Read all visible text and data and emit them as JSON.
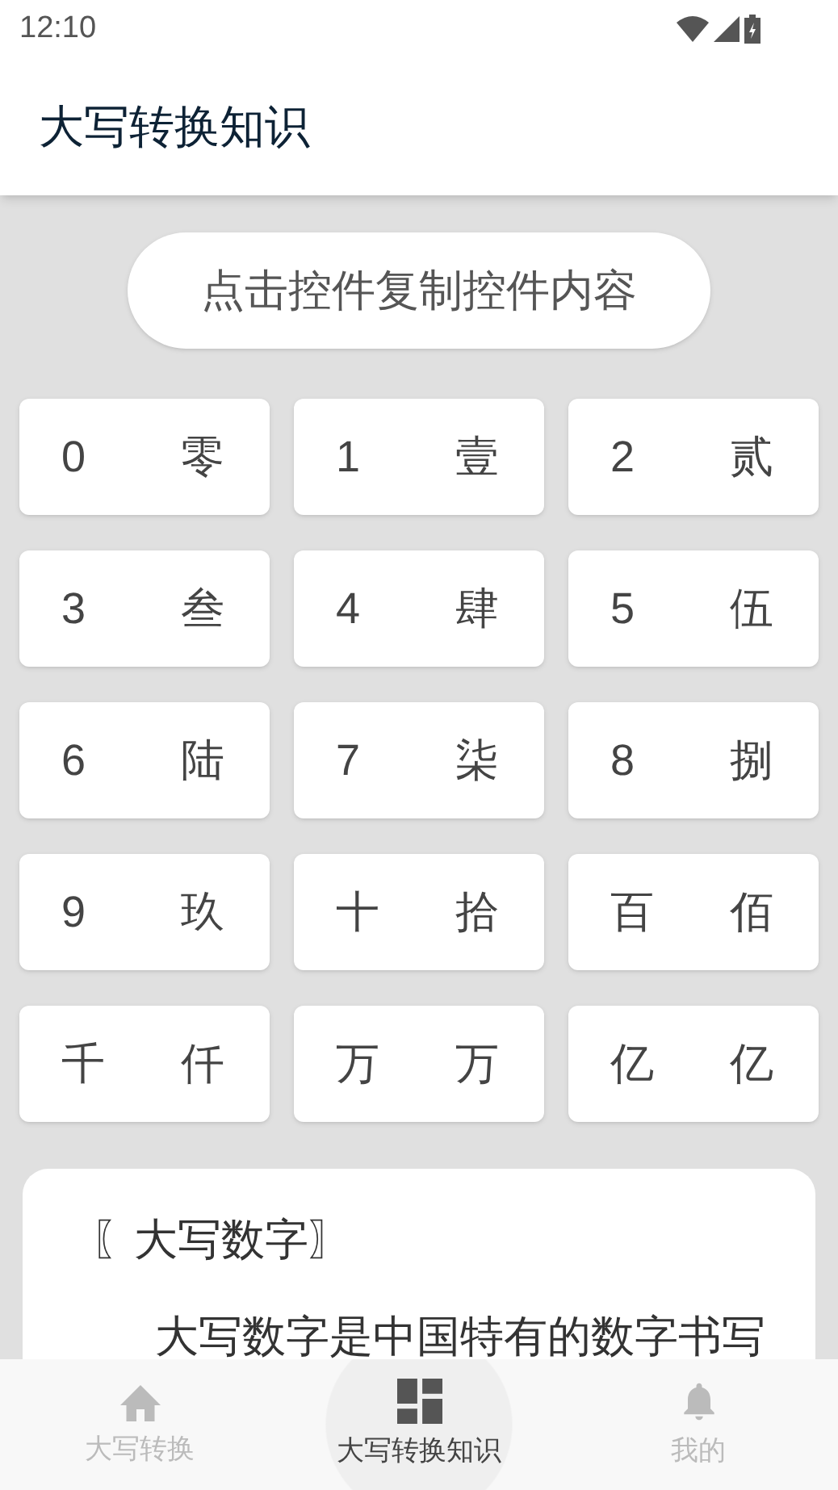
{
  "status_bar": {
    "time": "12:10"
  },
  "app_bar": {
    "title": "大写转换知识"
  },
  "copy_hint": "点击控件复制控件内容",
  "digits": [
    {
      "digit": "0",
      "upper": "零"
    },
    {
      "digit": "1",
      "upper": "壹"
    },
    {
      "digit": "2",
      "upper": "贰"
    },
    {
      "digit": "3",
      "upper": "叁"
    },
    {
      "digit": "4",
      "upper": "肆"
    },
    {
      "digit": "5",
      "upper": "伍"
    },
    {
      "digit": "6",
      "upper": "陆"
    },
    {
      "digit": "7",
      "upper": "柒"
    },
    {
      "digit": "8",
      "upper": "捌"
    },
    {
      "digit": "9",
      "upper": "玖"
    },
    {
      "digit": "十",
      "upper": "拾"
    },
    {
      "digit": "百",
      "upper": "佰"
    },
    {
      "digit": "千",
      "upper": "仟"
    },
    {
      "digit": "万",
      "upper": "万"
    },
    {
      "digit": "亿",
      "upper": "亿"
    }
  ],
  "info_card": {
    "heading": "〖大写数字〗",
    "body": "大写数字是中国特有的数字书写"
  },
  "bottom_nav": [
    {
      "label": "大写转换",
      "kind": "home",
      "selected": false
    },
    {
      "label": "大写转换知识",
      "kind": "dashboard",
      "selected": true
    },
    {
      "label": "我的",
      "kind": "bell",
      "selected": false
    }
  ]
}
